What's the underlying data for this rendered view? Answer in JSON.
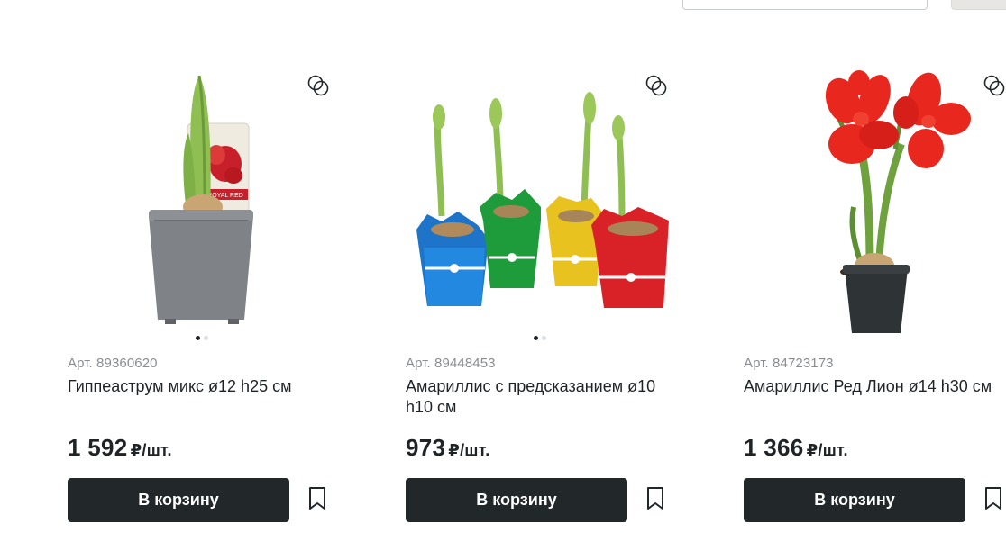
{
  "header": {
    "search_value": "",
    "filter_label": ""
  },
  "products": [
    {
      "article": "Арт. 89360620",
      "title": "Гиппеаструм микс ø12 h25 см",
      "price": "1 592",
      "unit": "₽/шт.",
      "cart_label": "В корзину",
      "image_icon": "potted-amaryllis-bud-image",
      "tag_text": "ROYAL RED"
    },
    {
      "article": "Арт. 89448453",
      "title": "Амариллис с предсказанием ø10 h10 см",
      "price": "973",
      "unit": "₽/шт.",
      "cart_label": "В корзину",
      "image_icon": "four-foil-wrapped-amaryllis-image"
    },
    {
      "article": "Арт. 84723173",
      "title": "Амариллис Ред Лион ø14 h30 см",
      "price": "1 366",
      "unit": "₽/шт.",
      "cart_label": "В корзину",
      "image_icon": "red-amaryllis-flower-image"
    }
  ],
  "icons": {
    "compare": "compare-icon",
    "bookmark": "bookmark-icon"
  },
  "colors": {
    "button_bg": "#22272a",
    "article_gray": "#8a8d90",
    "text": "#1f2326"
  }
}
